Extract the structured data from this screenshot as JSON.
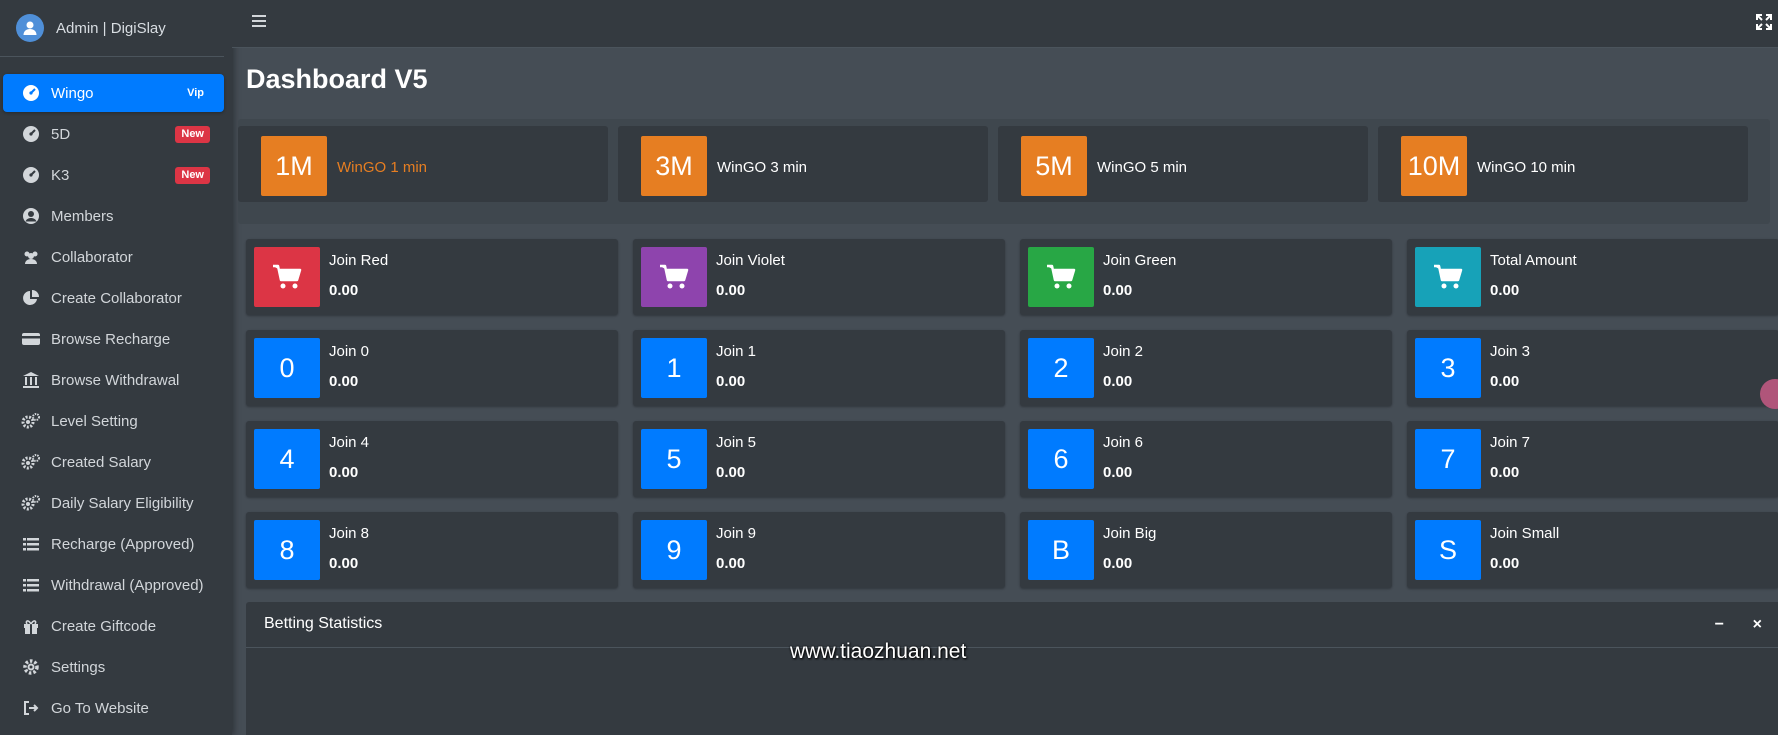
{
  "brand": {
    "name": "Admin | DigiSlay"
  },
  "sidebar": {
    "items": [
      {
        "label": "Wingo",
        "icon": "dashboard-gauge-icon",
        "badge": "Vip",
        "active": true
      },
      {
        "label": "5D",
        "icon": "dashboard-gauge-icon",
        "badge": "New"
      },
      {
        "label": "K3",
        "icon": "dashboard-gauge-icon",
        "badge": "New"
      },
      {
        "label": "Members",
        "icon": "user-circle-icon"
      },
      {
        "label": "Collaborator",
        "icon": "users-icon"
      },
      {
        "label": "Create Collaborator",
        "icon": "pie-chart-icon"
      },
      {
        "label": "Browse Recharge",
        "icon": "credit-card-icon"
      },
      {
        "label": "Browse Withdrawal",
        "icon": "bank-icon"
      },
      {
        "label": "Level Setting",
        "icon": "gears-icon"
      },
      {
        "label": "Created Salary",
        "icon": "gears-icon"
      },
      {
        "label": "Daily Salary Eligibility",
        "icon": "gears-icon"
      },
      {
        "label": "Recharge (Approved)",
        "icon": "list-icon"
      },
      {
        "label": "Withdrawal (Approved)",
        "icon": "list-icon"
      },
      {
        "label": "Create Giftcode",
        "icon": "gift-icon"
      },
      {
        "label": "Settings",
        "icon": "gear-icon"
      },
      {
        "label": "Go To Website",
        "icon": "sign-out-icon"
      }
    ]
  },
  "topbar": {
    "menu_icon": "hamburger-icon",
    "fullscreen_icon": "expand-icon"
  },
  "page": {
    "title": "Dashboard V5"
  },
  "wingo_tabs": [
    {
      "badge": "1M",
      "label": "WinGO 1 min",
      "active": true
    },
    {
      "badge": "3M",
      "label": "WinGO 3 min"
    },
    {
      "badge": "5M",
      "label": "WinGO 5 min"
    },
    {
      "badge": "10M",
      "label": "WinGO 10 min"
    }
  ],
  "colors": {
    "orange": "#e67e22",
    "red": "#dc3545",
    "violet": "#8e44ad",
    "green": "#28a745",
    "teal": "#17a2b8",
    "blue": "#007bff"
  },
  "boxes": [
    {
      "symbol": "cart",
      "title": "Join Red",
      "value": "0.00",
      "color": "#dc3545"
    },
    {
      "symbol": "cart",
      "title": "Join Violet",
      "value": "0.00",
      "color": "#8e44ad"
    },
    {
      "symbol": "cart",
      "title": "Join Green",
      "value": "0.00",
      "color": "#28a745"
    },
    {
      "symbol": "cart",
      "title": "Total Amount",
      "value": "0.00",
      "color": "#17a2b8"
    },
    {
      "symbol": "0",
      "title": "Join 0",
      "value": "0.00",
      "color": "#007bff"
    },
    {
      "symbol": "1",
      "title": "Join 1",
      "value": "0.00",
      "color": "#007bff"
    },
    {
      "symbol": "2",
      "title": "Join 2",
      "value": "0.00",
      "color": "#007bff"
    },
    {
      "symbol": "3",
      "title": "Join 3",
      "value": "0.00",
      "color": "#007bff"
    },
    {
      "symbol": "4",
      "title": "Join 4",
      "value": "0.00",
      "color": "#007bff"
    },
    {
      "symbol": "5",
      "title": "Join 5",
      "value": "0.00",
      "color": "#007bff"
    },
    {
      "symbol": "6",
      "title": "Join 6",
      "value": "0.00",
      "color": "#007bff"
    },
    {
      "symbol": "7",
      "title": "Join 7",
      "value": "0.00",
      "color": "#007bff"
    },
    {
      "symbol": "8",
      "title": "Join 8",
      "value": "0.00",
      "color": "#007bff"
    },
    {
      "symbol": "9",
      "title": "Join 9",
      "value": "0.00",
      "color": "#007bff"
    },
    {
      "symbol": "B",
      "title": "Join Big",
      "value": "0.00",
      "color": "#007bff"
    },
    {
      "symbol": "S",
      "title": "Join Small",
      "value": "0.00",
      "color": "#007bff"
    }
  ],
  "stats": {
    "title": "Betting Statistics",
    "minimize": "−",
    "close": "×"
  },
  "watermark": "www.tiaozhuan.net"
}
